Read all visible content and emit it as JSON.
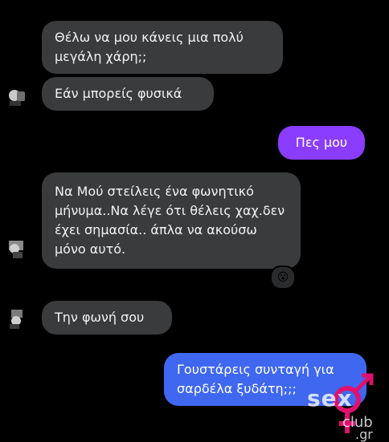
{
  "messages": [
    {
      "direction": "incoming",
      "text": "Θέλω να μου κάνεις μια πολύ μεγάλη χάρη;;"
    },
    {
      "direction": "incoming",
      "text": "Εάν μπορείς φυσικά"
    },
    {
      "direction": "outgoing",
      "text": "Πες μου"
    },
    {
      "direction": "incoming",
      "text": "Να Μού στείλεις ένα φωνητικό μήνυμα..Να  λέγε ότι θέλεις χαχ.δεν έχει σημασία.. άπλα να ακούσω μόνο αυτό."
    },
    {
      "direction": "incoming",
      "text": "Την  φωνή σου"
    },
    {
      "direction": "outgoing",
      "text": "Γουστάρεις συνταγή για σαρδέλα ξυδάτη;;;"
    }
  ],
  "reaction": {
    "emoji": "😮",
    "icon": "surprised-face-emoji"
  },
  "watermark": {
    "brand": "sex",
    "sub": "club",
    "tld": ".gr"
  },
  "colors": {
    "background": "#000000",
    "incoming_bubble": "#3a3b3c",
    "outgoing_purple": "#8a3dff",
    "outgoing_blue": "#3f67f0",
    "watermark_pink": "#e0106e"
  }
}
